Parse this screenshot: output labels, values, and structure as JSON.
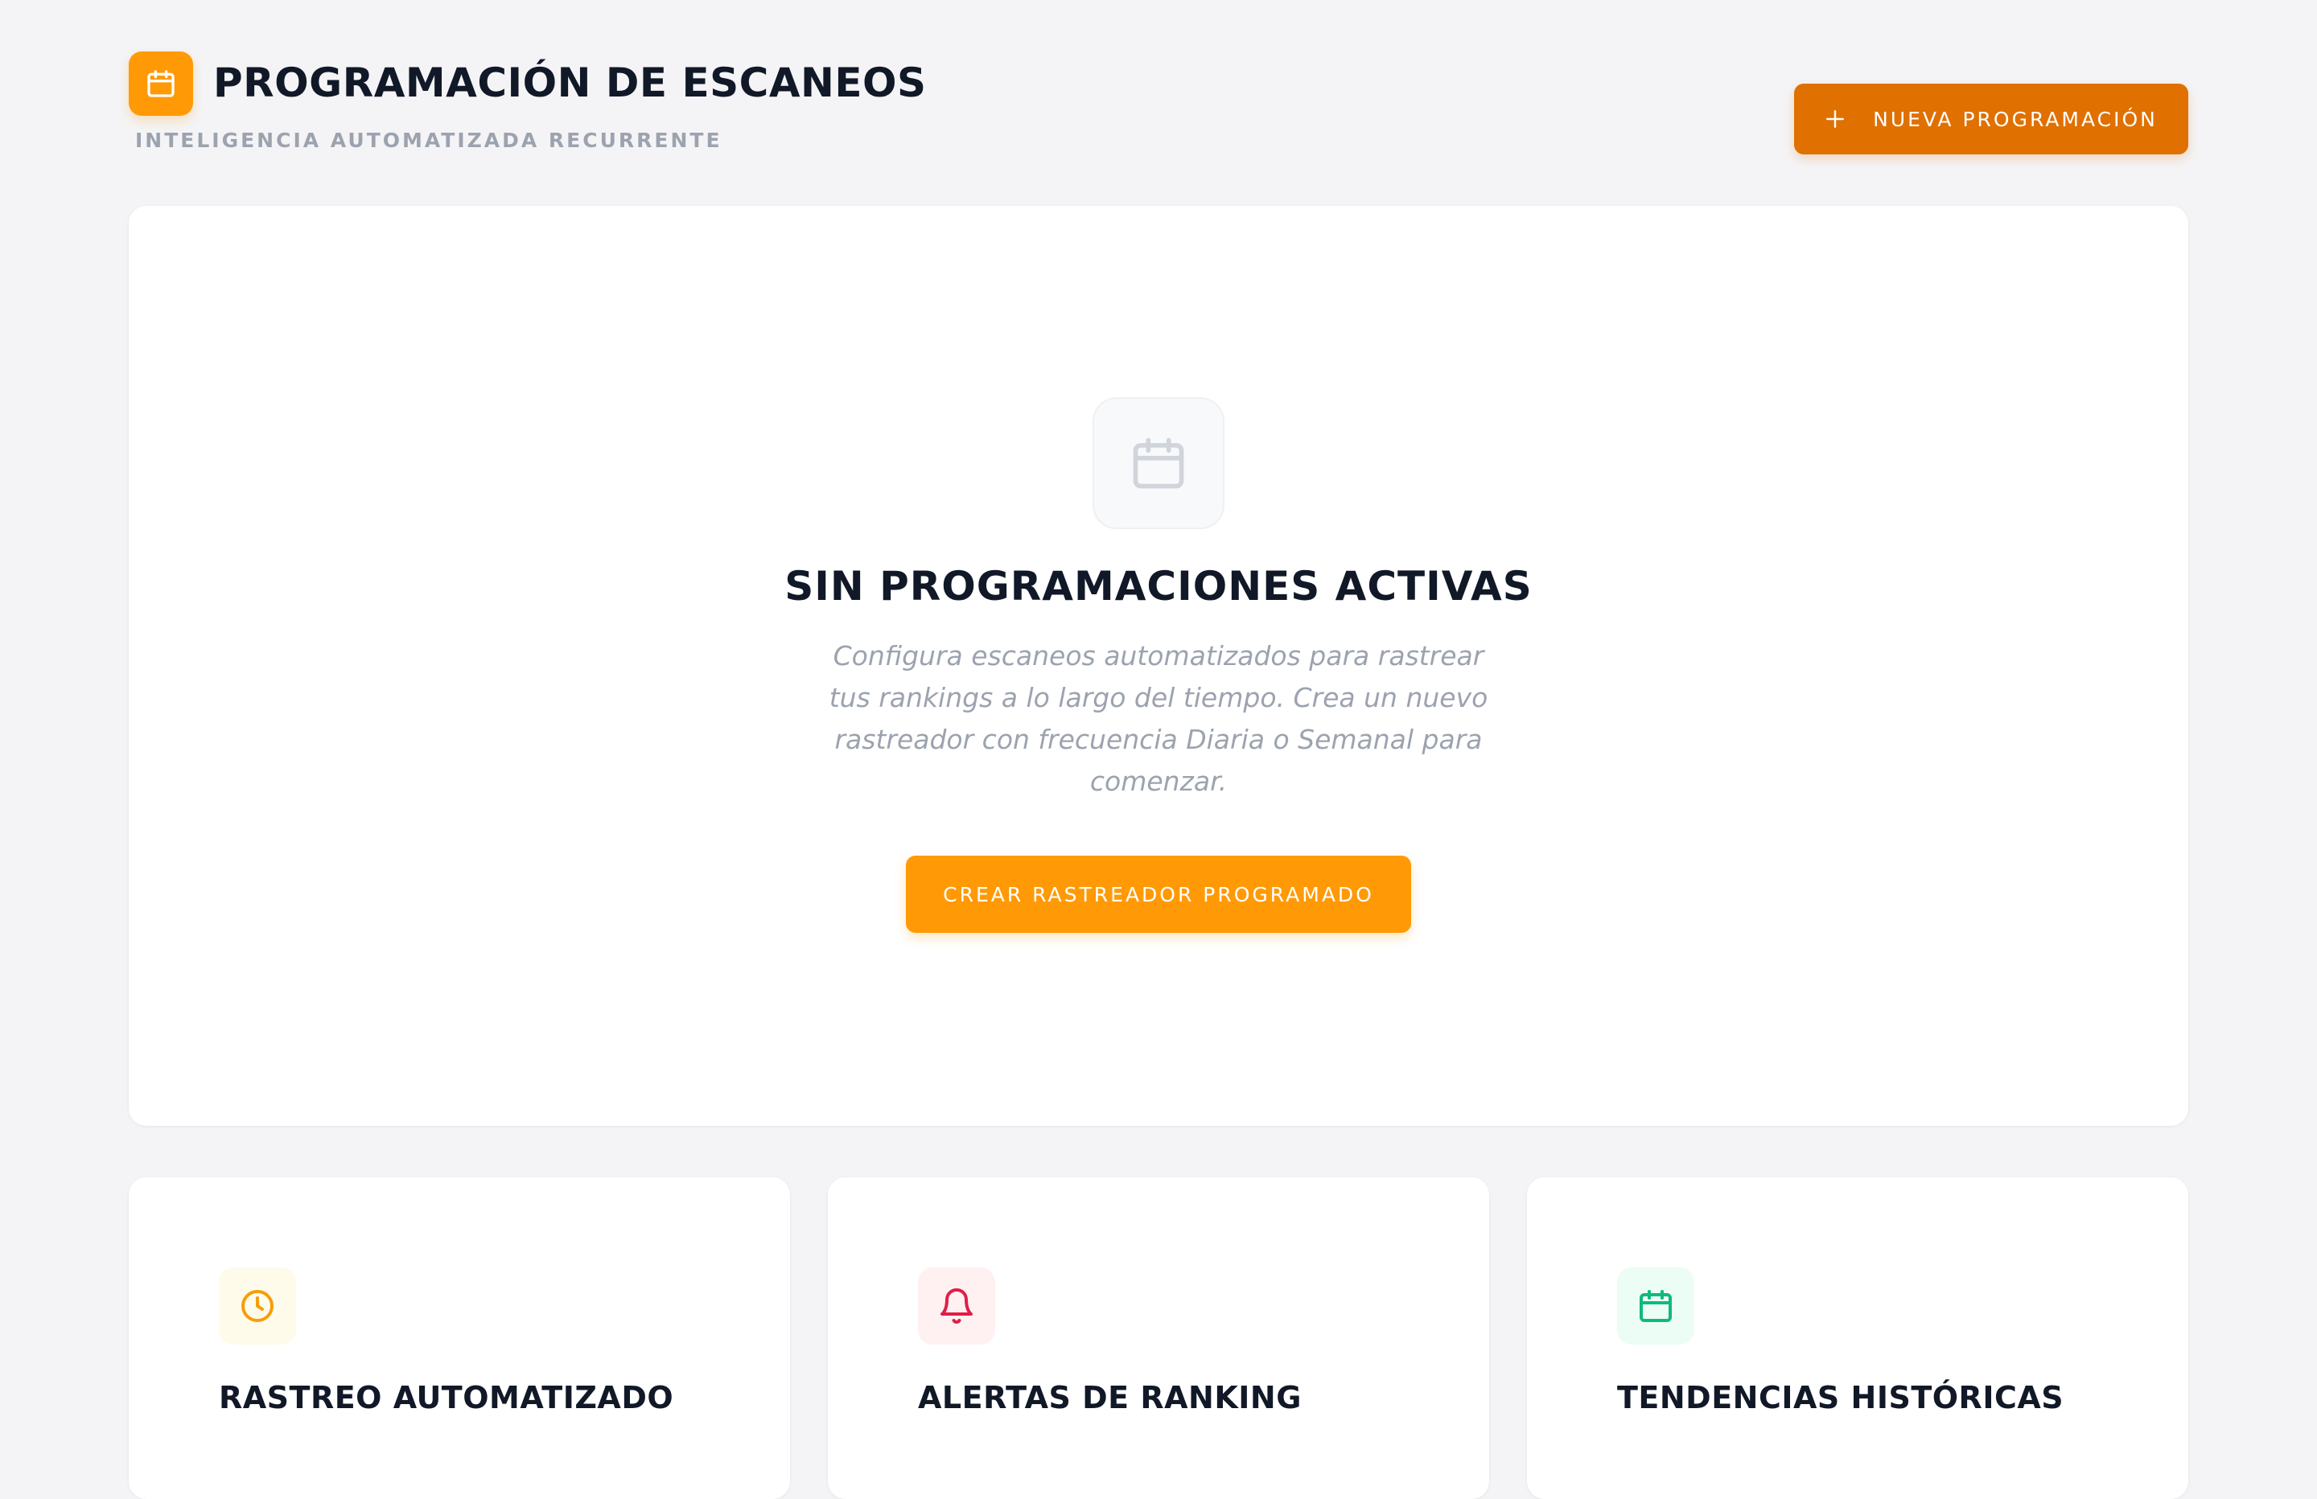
{
  "header": {
    "title": "PROGRAMACIÓN DE ESCANEOS",
    "subtitle": "INTELIGENCIA AUTOMATIZADA RECURRENTE",
    "logo_icon": "calendar-icon",
    "new_button_label": "NUEVA PROGRAMACIÓN",
    "new_button_icon": "plus-icon"
  },
  "empty_state": {
    "icon": "calendar-icon",
    "title": "SIN PROGRAMACIONES ACTIVAS",
    "description": "Configura escaneos automatizados para rastrear tus rankings a lo largo del tiempo. Crea un nuevo rastreador con frecuencia Diaria o Semanal para comenzar.",
    "button_label": "CREAR RASTREADOR PROGRAMADO"
  },
  "features": [
    {
      "title": "RASTREO AUTOMATIZADO",
      "icon": "clock-icon",
      "color": "#f59e0b",
      "bg": "#fffbeb"
    },
    {
      "title": "ALERTAS DE RANKING",
      "icon": "bell-icon",
      "color": "#e11d48",
      "bg": "#fff1f2"
    },
    {
      "title": "TENDENCIAS HISTÓRICAS",
      "icon": "calendar-icon",
      "color": "#10b981",
      "bg": "#ecfdf5"
    }
  ],
  "colors": {
    "accent": "#ff9a06",
    "accent_dark": "#e07000",
    "background": "#f4f4f6",
    "text_primary": "#111827",
    "text_muted": "#9ca3af"
  }
}
